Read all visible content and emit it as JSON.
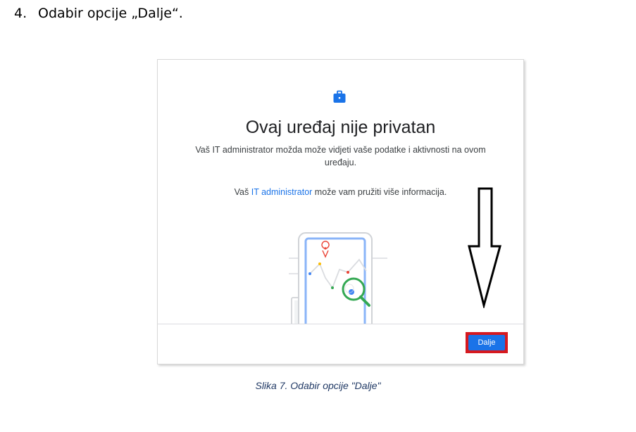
{
  "step": {
    "number": "4.",
    "text": "Odabir opcije „Dalje“."
  },
  "dialog": {
    "title": "Ovaj uređaj nije privatan",
    "description": "Vaš IT administrator možda može vidjeti vaše podatke i aktivnosti na ovom uređaju.",
    "info_before": "Vaš ",
    "info_link": "IT administrator",
    "info_after": " može vam pružiti više informacija.",
    "next_label": "Dalje"
  },
  "caption": "Slika 7. Odabir opcije \"Dalje\"",
  "colors": {
    "accent": "#1a73e8",
    "highlight_frame": "#d6191f",
    "caption": "#1f3864"
  },
  "icons": [
    "briefcase-icon",
    "phone-map-illustration",
    "magnifier-icon",
    "down-arrow-annotation"
  ]
}
